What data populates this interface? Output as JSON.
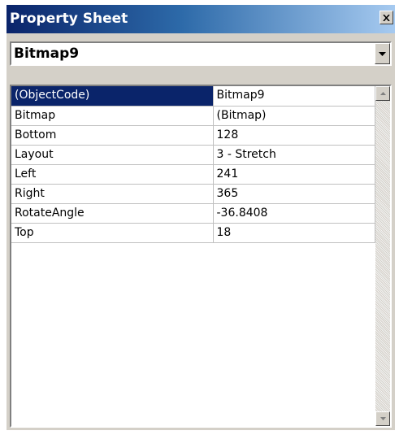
{
  "window": {
    "title": "Property Sheet",
    "icons": {
      "close": "close-icon"
    }
  },
  "object_selector": {
    "value": "Bitmap9",
    "icon": "chevron-down-icon"
  },
  "properties": [
    {
      "name": "(ObjectCode)",
      "value": "Bitmap9"
    },
    {
      "name": "Bitmap",
      "value": "(Bitmap)"
    },
    {
      "name": "Bottom",
      "value": "128"
    },
    {
      "name": "Layout",
      "value": "3 - Stretch"
    },
    {
      "name": "Left",
      "value": "241"
    },
    {
      "name": "Right",
      "value": "365"
    },
    {
      "name": "RotateAngle",
      "value": "-36.8408"
    },
    {
      "name": "Top",
      "value": "18"
    }
  ],
  "selected_property": "(ObjectCode)",
  "colors": {
    "title_gradient_start": "#0a246a",
    "title_gradient_end": "#a6caf0",
    "selection": "#0a246a",
    "face": "#d4d0c8"
  }
}
